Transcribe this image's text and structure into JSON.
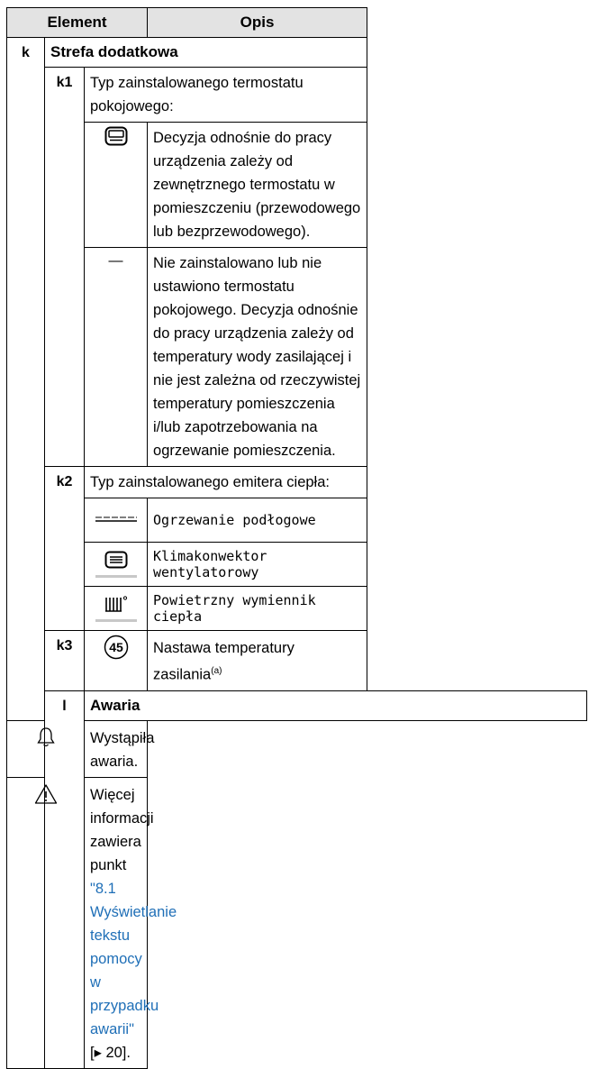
{
  "header": {
    "col1": "Element",
    "col2": "Opis"
  },
  "k": {
    "key": "k",
    "title": "Strefa dodatkowa",
    "k1": {
      "key": "k1",
      "label": "Typ zainstalowanego termostatu pokojowego:",
      "rows": [
        {
          "icon": "room-thermostat-icon",
          "text": "Decyzja odnośnie do pracy urządzenia zależy od zewnętrznego termostatu w pomieszczeniu (przewodowego lub bezprzewodowego)."
        },
        {
          "icon_text": "—",
          "text": "Nie zainstalowano lub nie ustawiono termostatu pokojowego. Decyzja odnośnie do pracy urządzenia zależy od temperatury wody zasilającej i nie jest zależna od rzeczywistej temperatury pomieszczenia i/lub zapotrzebowania na ogrzewanie pomieszczenia."
        }
      ]
    },
    "k2": {
      "key": "k2",
      "label": "Typ zainstalowanego emitera ciepła:",
      "rows": [
        {
          "icon": "underfloor-heating-icon",
          "text": "Ogrzewanie podłogowe"
        },
        {
          "icon": "fan-coil-unit-icon",
          "text": "Klimakonwektor wentylatorowy"
        },
        {
          "icon": "radiator-icon",
          "text": "Powietrzny wymiennik ciepła"
        }
      ]
    },
    "k3": {
      "key": "k3",
      "icon_text": "45",
      "text": "Nastawa temperatury zasilania",
      "footnote": "(a)"
    }
  },
  "l": {
    "key": "l",
    "title": "Awaria",
    "rows": [
      {
        "icon": "bell-icon",
        "text": "Wystąpiła awaria."
      },
      {
        "icon": "warning-icon",
        "text_before": "Więcej informacji zawiera punkt ",
        "link": "\"8.1 Wyświetlanie tekstu pomocy w przypadku awarii\"",
        "ref": " [▸ 20]."
      }
    ]
  }
}
